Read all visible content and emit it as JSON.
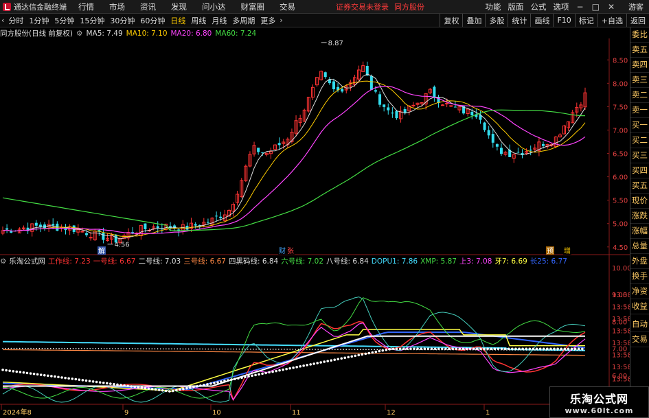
{
  "app": {
    "title": "通达信金融终端"
  },
  "menu": [
    "行情",
    "市场",
    "资讯",
    "发现",
    "问小达",
    "财富圈",
    "交易"
  ],
  "notice": {
    "text1": "证券交易未登录",
    "text2": "同方股份"
  },
  "menu_right": [
    "功能",
    "版面",
    "公式",
    "选项"
  ],
  "guest": "游客",
  "toolbar": {
    "periods": [
      "分时",
      "1分钟",
      "5分钟",
      "15分钟",
      "30分钟",
      "60分钟",
      "日线",
      "周线",
      "月线",
      "多周期",
      "更多"
    ],
    "active": "日线",
    "right": [
      "复权",
      "叠加",
      "多股",
      "统计",
      "画线",
      "F10",
      "标记",
      "+自选",
      "返回"
    ]
  },
  "upper_legend": {
    "title": "同方股份(日线 前复权)",
    "items": [
      {
        "label": "MA5: 7.49",
        "color": "#dddddd"
      },
      {
        "label": "MA10: 7.10",
        "color": "#ffcc00"
      },
      {
        "label": "MA20: 6.80",
        "color": "#ff44ff"
      },
      {
        "label": "MA60: 7.24",
        "color": "#44dd44"
      }
    ]
  },
  "lower_legend": {
    "title": "乐淘公式网",
    "items": [
      {
        "label": "工作线: 7.23",
        "color": "#ff3333"
      },
      {
        "label": "一号线: 6.67",
        "color": "#ff3333"
      },
      {
        "label": "二号线: 7.03",
        "color": "#dddddd"
      },
      {
        "label": "三号线: 6.67",
        "color": "#ff8844"
      },
      {
        "label": "四黑码线: 6.84",
        "color": "#dddddd"
      },
      {
        "label": "六号线: 7.02",
        "color": "#44dd44"
      },
      {
        "label": "八号线: 6.84",
        "color": "#dddddd"
      },
      {
        "label": "DOPU1: 7.86",
        "color": "#44ddff"
      },
      {
        "label": "XMP: 5.87",
        "color": "#44dd44"
      },
      {
        "label": "上3: 7.08",
        "color": "#ff44ff"
      },
      {
        "label": "牙7: 6.69",
        "color": "#ffff44"
      },
      {
        "label": "长25: 6.77",
        "color": "#3366ff"
      }
    ]
  },
  "right_panel": [
    "委比",
    "卖五",
    "卖四",
    "卖三",
    "卖二",
    "卖一",
    "买一",
    "买二",
    "买三",
    "买四",
    "买五",
    "现价",
    "涨跌",
    "涨幅",
    "总量",
    "外盘",
    "换手",
    "净资",
    "收益",
    "自动",
    "交易"
  ],
  "price_axis": [
    "8.50",
    "8.00",
    "7.50",
    "7.00",
    "6.50",
    "6.00",
    "5.50",
    "5.00",
    "4.50"
  ],
  "ind_axis": [
    "10.00",
    "9.00",
    "8.00",
    "7.00",
    "6.00"
  ],
  "time_axis_right": [
    "13:58",
    "13:58",
    "13:58",
    "13:58",
    "13:58",
    "13:58",
    "13:58",
    "13:58"
  ],
  "date_axis": [
    "2024年8",
    "9",
    "10",
    "11",
    "12",
    "1"
  ],
  "annotations": {
    "high": "8.87",
    "low": "4.56",
    "tag_left": "解",
    "tag_mid": "财",
    "tag_mid2": "张",
    "tag_r1": "预",
    "tag_r2": "增"
  },
  "watermark": {
    "line1": "乐淘公式网",
    "line2": "www.60lt.com"
  },
  "colors": {
    "up": "#ff3333",
    "down": "#33ddee",
    "bg": "#000000"
  }
}
